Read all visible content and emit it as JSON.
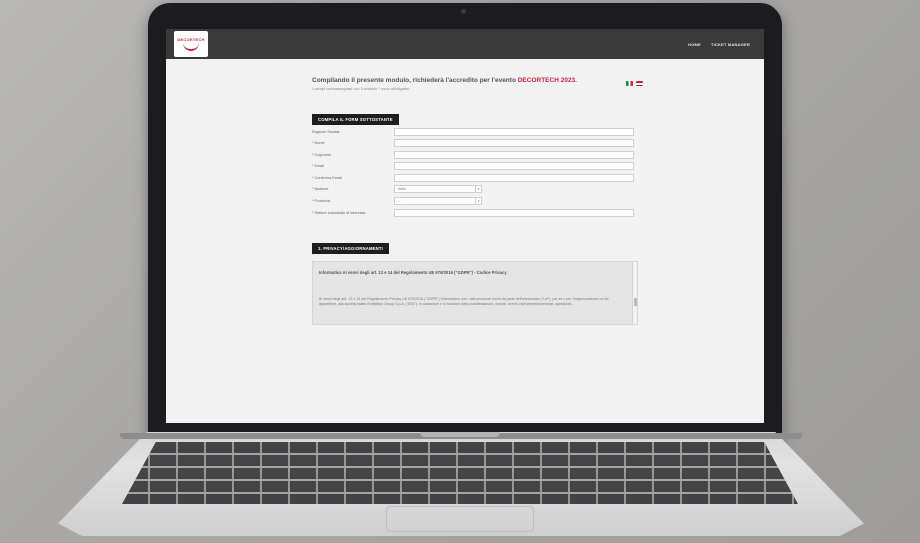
{
  "header": {
    "logo_text": "DECORTECH",
    "nav": [
      "HOME",
      "TICKET MANAGER"
    ]
  },
  "intro": {
    "title_before": "Compilando il presente modulo, richiederà l'accredito per l'evento ",
    "title_brand": "DECORTECH 2023",
    "title_after": ".",
    "subtitle": "I campi contrassegnati con il simbolo * sono obbligatori"
  },
  "form": {
    "section_label": "COMPILA IL FORM SOTTOSTANTE",
    "fields": [
      "Ragione Sociale",
      "* Nome",
      "* Cognome",
      "* Email",
      "* Conferma Email",
      "* Nazione",
      "* Provincia",
      "* Settore industriale di interesse"
    ],
    "nazione_value": "Italia",
    "provincia_value": "--"
  },
  "privacy": {
    "section_label": "1. PRIVACY/AGGIORNAMENTI",
    "title": "Informativa Ai sensi degli art. 13 e 14 del Regolamento UE 679/2016 (\"GDPR\") - Codice Privacy",
    "text": "Ai sensi degli artt. 13 e 14 del Regolamento Privacy UE 679/2016 (\"GDPR\") l'informiamo che i dati personali forniti da parte dell'interessato (\"Lei\"), per sé o per l'organizzazione cui lei appartiene, alla società Italian Exhibition Group S.p.A. (\"IEG\"), in occasione e in funzione della manifestazioni, mostre, eventi, ricevimenti/cerimonie, spedizioni..."
  },
  "colors": {
    "accent": "#d0253a",
    "topbar": "#3a3a3a",
    "button": "#1e1e1e"
  }
}
